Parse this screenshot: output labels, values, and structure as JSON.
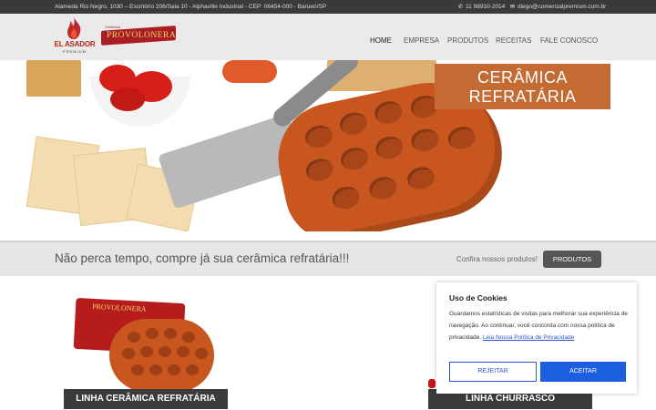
{
  "topbar": {
    "address": "Alameda Rio Negro, 1030 – Escritório 206/Sala 10 - Alphaville Industrial - CEP: 06454-000 - Barueri/SP",
    "phone": "11 98910-2014",
    "email": "diego@comercialpremium.com.br",
    "phone_icon": "phone-icon",
    "email_icon": "envelope-icon"
  },
  "logos": {
    "brand_main": "EL ASADOR",
    "brand_sub": "PREMIUM",
    "brand_second_small": "Cerâmica",
    "brand_second": "PROVOLONERA"
  },
  "nav": {
    "items": [
      "HOME",
      "EMPRESA",
      "PRODUTOS",
      "RECEITAS",
      "FALE CONOSCO"
    ],
    "active": "HOME"
  },
  "banner": {
    "title_line1": "CERÂMICA",
    "title_line2": "REFRATÁRIA"
  },
  "promo": {
    "headline": "Não perca tempo, compre já sua cerâmica refratária!!!",
    "cta_text": "Confira nossos produtos!",
    "button_label": "PRODUTOS"
  },
  "products": [
    {
      "label": "LINHA CERÂMICA REFRATÁRIA",
      "box_name": "PROVOLONERA"
    },
    {
      "label": "LINHA CHURRASCO"
    }
  ],
  "cookie": {
    "title": "Uso de Cookies",
    "text": "Guardamos estatísticas de visitas para melhorar sua experiência de navegação. Ao continuar, você concorda com nossa política de privacidade.",
    "link": "Leia Nossa Política de Privacidade",
    "reject": "REJEITAR",
    "accept": "ACEITAR"
  },
  "colors": {
    "topbar": "#3a3a3a",
    "brand_red": "#a81e22",
    "terracotta": "#c8561e",
    "accent_blue": "#1b5ee0"
  }
}
